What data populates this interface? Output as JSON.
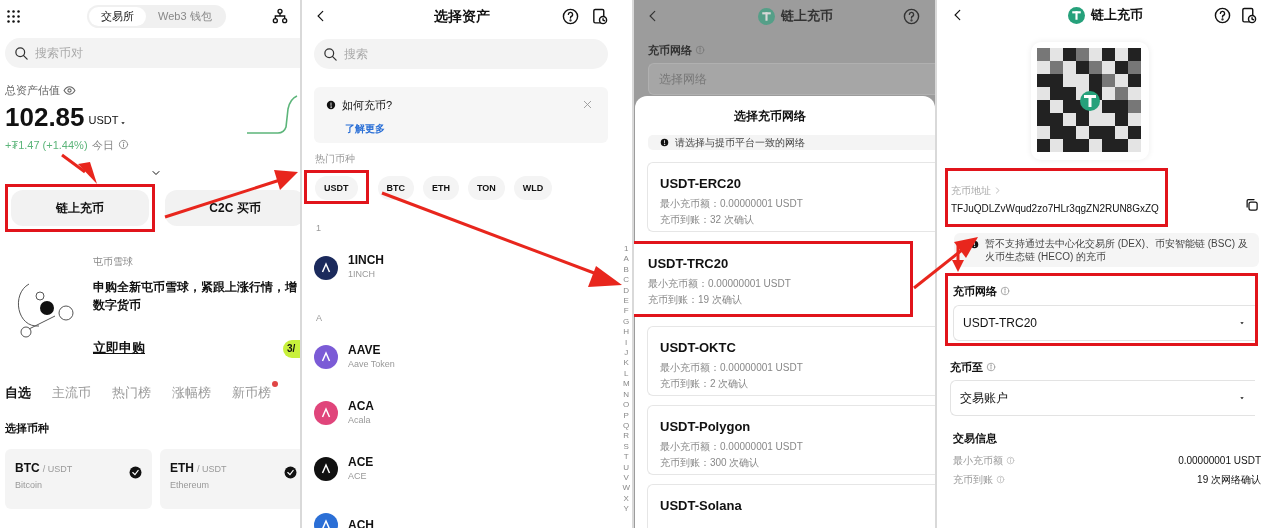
{
  "home": {
    "tabs": [
      {
        "label": "交易所",
        "selected": true
      },
      {
        "label": "Web3 钱包",
        "selected": false
      }
    ],
    "search": {
      "placeholder": "搜索币对"
    },
    "balance_label": "总资产估值",
    "balance": "102.85",
    "currency": "USDT",
    "change": "+₮1.47 (+1.44%)",
    "change_period": "今日",
    "actions": [
      {
        "label": "链上充币",
        "highlighted": true
      },
      {
        "label": "C2C 买币",
        "highlighted": false
      }
    ],
    "promo": {
      "label": "屯币雪球",
      "lines": [
        "申购全新屯币雪球，紧跟上涨行情，增",
        "数字货币"
      ],
      "link": "立即申购",
      "badge": "3/"
    },
    "market_tabs": [
      {
        "label": "自选",
        "selected": true,
        "dot": false
      },
      {
        "label": "主流币",
        "selected": false,
        "dot": false
      },
      {
        "label": "热门榜",
        "selected": false,
        "dot": false
      },
      {
        "label": "涨幅榜",
        "selected": false,
        "dot": false
      },
      {
        "label": "新币榜",
        "selected": false,
        "dot": true
      }
    ],
    "section_title": "选择币种",
    "pairs": [
      {
        "base": "BTC",
        "quote": "/ USDT",
        "name": "Bitcoin",
        "checked": true
      },
      {
        "base": "ETH",
        "quote": "/ USDT",
        "name": "Ethereum",
        "checked": true
      }
    ]
  },
  "select_asset": {
    "title": "选择资产",
    "search": {
      "placeholder": "搜索"
    },
    "notice": {
      "title": "如何充币?",
      "link": "了解更多"
    },
    "hot_label": "热门币种",
    "hot_coins": [
      {
        "label": "USDT",
        "highlighted": true
      },
      {
        "label": "BTC",
        "highlighted": false
      },
      {
        "label": "ETH",
        "highlighted": false
      },
      {
        "label": "TON",
        "highlighted": false
      },
      {
        "label": "WLD",
        "highlighted": false
      }
    ],
    "groups": [
      {
        "letter": "1",
        "coins": [
          {
            "symbol": "1INCH",
            "name": "1INCH",
            "color": "#1b2a5c"
          }
        ]
      },
      {
        "letter": "A",
        "coins": [
          {
            "symbol": "AAVE",
            "name": "Aave Token",
            "color": "#7b5bd6"
          },
          {
            "symbol": "ACA",
            "name": "Acala",
            "color": "#e0457b"
          },
          {
            "symbol": "ACE",
            "name": "ACE",
            "color": "#111111"
          },
          {
            "symbol": "ACH",
            "color": "#2b6fd6"
          }
        ]
      }
    ],
    "index": [
      "1",
      "A",
      "B",
      "C",
      "D",
      "E",
      "F",
      "G",
      "H",
      "I",
      "J",
      "K",
      "L",
      "M",
      "N",
      "O",
      "P",
      "Q",
      "R",
      "S",
      "T",
      "U",
      "V",
      "W",
      "X",
      "Y"
    ]
  },
  "network_sheet": {
    "title": "链上充币",
    "field_label": "充币网络",
    "field_placeholder": "选择网络",
    "sheet_title": "选择充币网络",
    "notice": "请选择与提币平台一致的网络",
    "networks": [
      {
        "name": "USDT-ERC20",
        "min": "最小充币额：0.00000001 USDT",
        "confirm": "充币到账：32 次确认",
        "highlighted": false
      },
      {
        "name": "USDT-TRC20",
        "min": "最小充币额：0.00000001 USDT",
        "confirm": "充币到账：19 次确认",
        "highlighted": true
      },
      {
        "name": "USDT-OKTC",
        "min": "最小充币额：0.00000001 USDT",
        "confirm": "充币到账：2 次确认",
        "highlighted": false
      },
      {
        "name": "USDT-Polygon",
        "min": "最小充币额：0.00000001 USDT",
        "confirm": "充币到账：300 次确认",
        "highlighted": false
      },
      {
        "name": "USDT-Solana",
        "highlighted": false
      }
    ]
  },
  "deposit": {
    "title": "链上充币",
    "address_label": "充币地址",
    "address": "TFJuQDLZvWqud2zo7HLr3qgZN2RUN8GxZQ",
    "address_highlighted": true,
    "notice": "暂不支持通过去中心化交易所 (DEX)、币安智能链 (BSC) 及火币生态链 (HECO) 的充币",
    "network": {
      "label": "充币网络",
      "value": "USDT-TRC20",
      "highlighted": true
    },
    "target": {
      "label": "充币至",
      "value": "交易账户",
      "highlighted": false
    },
    "info_title": "交易信息",
    "info": [
      {
        "label": "最小充币额",
        "value": "0.00000001 USDT"
      },
      {
        "label": "充币到账",
        "value": "19 次网络确认"
      }
    ]
  }
}
